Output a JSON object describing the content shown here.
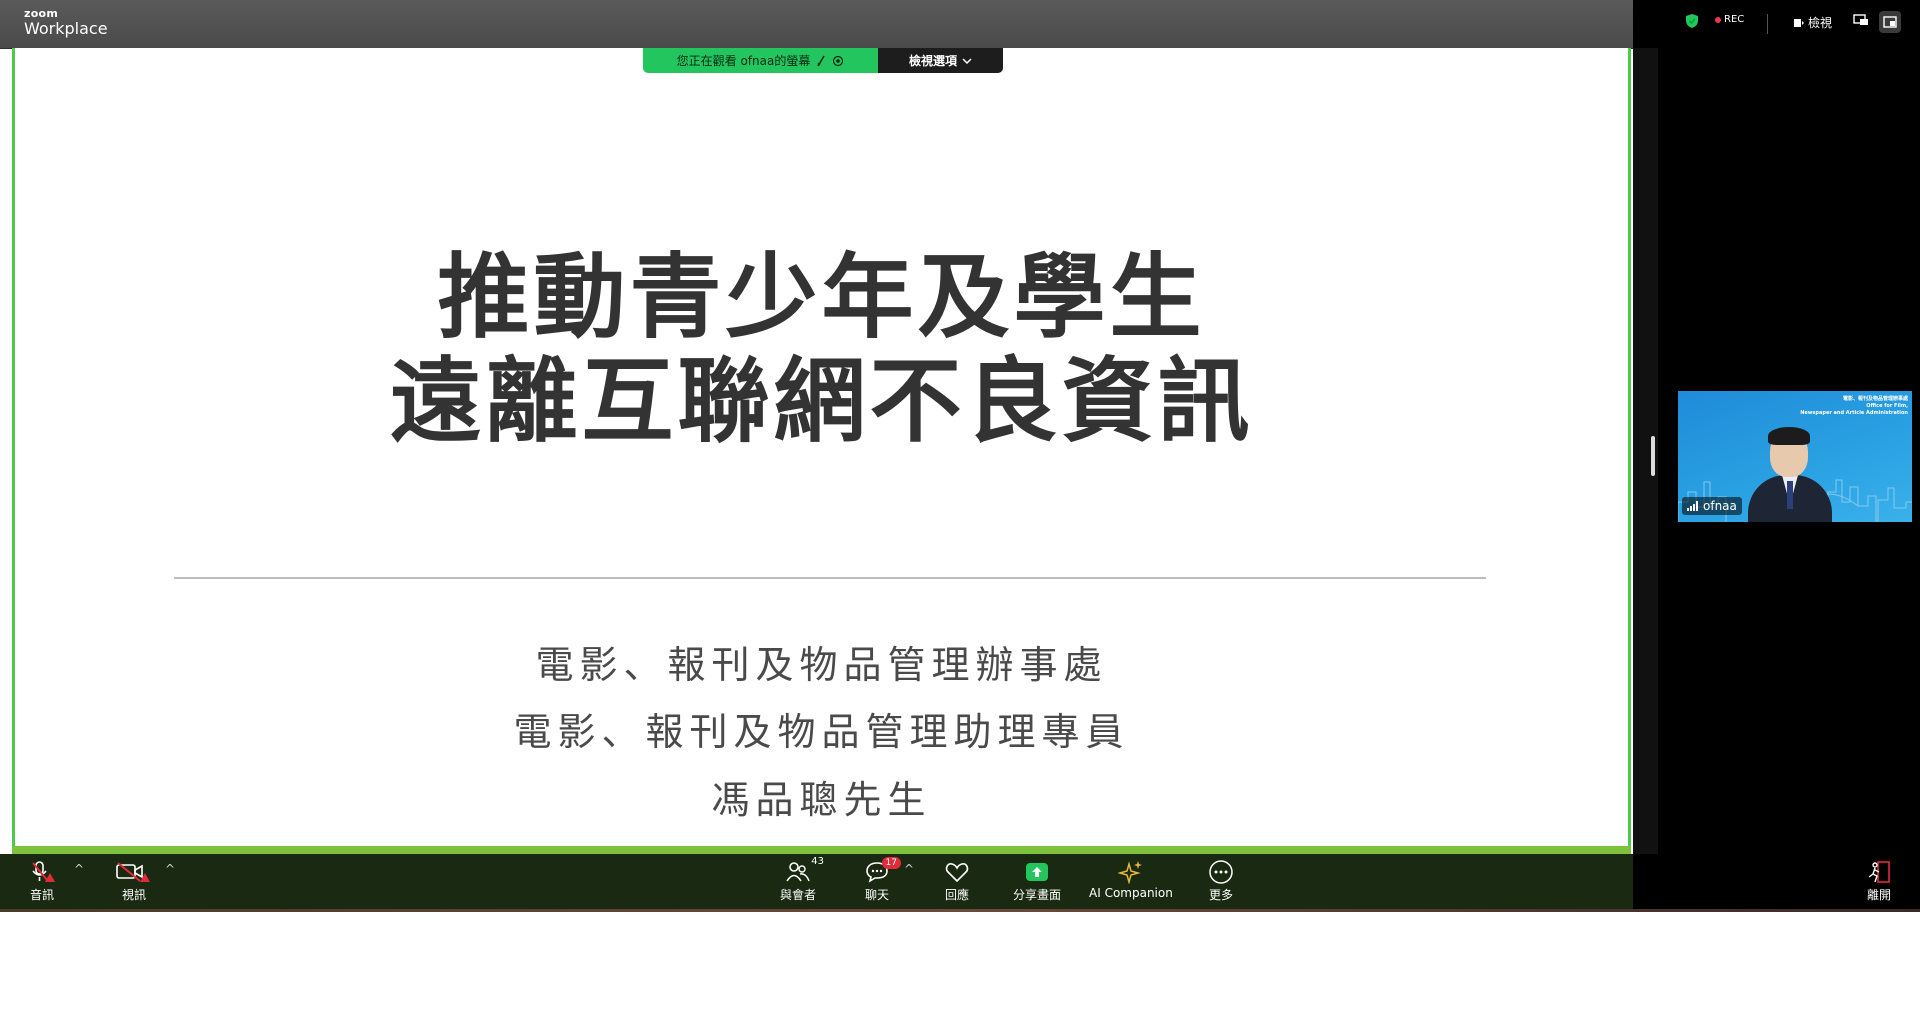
{
  "app": {
    "brand_small": "zoom",
    "brand_name": "Workplace"
  },
  "top_right": {
    "rec_label": "REC",
    "view_label": "檢視"
  },
  "banner": {
    "viewing_text": "您正在觀看 ofnaa的螢幕",
    "options_label": "檢視選項"
  },
  "slide": {
    "title_line1": "推動青少年及學生",
    "title_line2": "遠離互聯網不良資訊",
    "subtitle1": "電影、報刊及物品管理辦事處",
    "subtitle2": "電影、報刊及物品管理助理專員",
    "subtitle3": "馮品聰先生"
  },
  "participant": {
    "name": "ofnaa",
    "org_line1": "電影、報刊及物品管理辦事處",
    "org_line2": "Office for Film,",
    "org_line3": "Newspaper and Article Administration"
  },
  "toolbar": {
    "audio": "音訊",
    "video": "視訊",
    "participants": "與會者",
    "participants_count": "43",
    "chat": "聊天",
    "chat_badge": "17",
    "react": "回應",
    "share": "分享畫面",
    "ai": "AI Companion",
    "more": "更多",
    "leave": "離開"
  },
  "colors": {
    "accent_green": "#22c55e",
    "share_border": "#4ec94b",
    "danger": "#e02b3a"
  }
}
